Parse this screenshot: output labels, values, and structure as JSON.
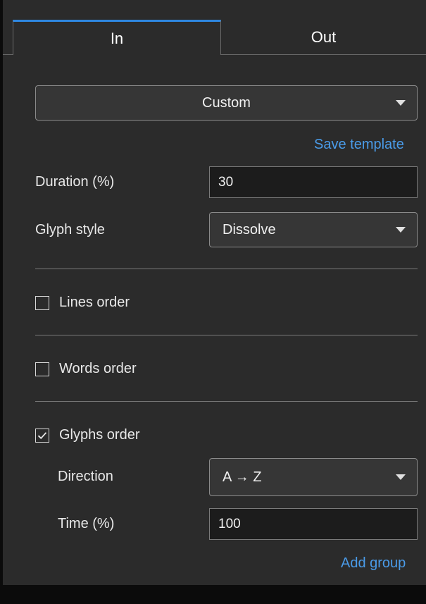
{
  "tabs": [
    {
      "label": "In",
      "active": true
    },
    {
      "label": "Out",
      "active": false
    }
  ],
  "preset": {
    "selected": "Custom"
  },
  "save_template_link": "Save template",
  "duration": {
    "label": "Duration (%)",
    "value": "30"
  },
  "glyph_style": {
    "label": "Glyph style",
    "selected": "Dissolve"
  },
  "lines_order": {
    "label": "Lines order",
    "checked": false
  },
  "words_order": {
    "label": "Words order",
    "checked": false
  },
  "glyphs_order": {
    "label": "Glyphs order",
    "checked": true,
    "direction": {
      "label": "Direction",
      "selected": "A → Z"
    },
    "time": {
      "label": "Time (%)",
      "value": "100"
    }
  },
  "add_group_link": "Add group",
  "colors": {
    "panel_bg": "#2b2b2b",
    "accent": "#2e86e0",
    "link": "#4a9be8"
  },
  "icons": {
    "dropdown": "chevron-down-icon",
    "check": "checkmark-icon"
  }
}
